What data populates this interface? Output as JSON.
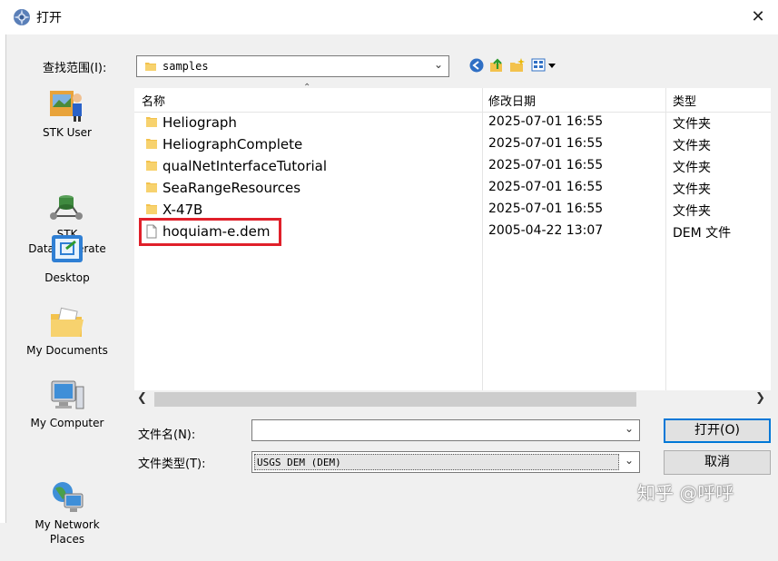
{
  "window": {
    "title": "打开",
    "close_glyph": "✕"
  },
  "look_in": {
    "label": "查找范围(I):",
    "value": "samples"
  },
  "places": [
    {
      "label": "STK User",
      "icon": "stk-user-icon"
    },
    {
      "label": "STK\nData Federate",
      "icon": "stk-data-federate-icon"
    },
    {
      "label": "Desktop",
      "icon": "desktop-icon"
    },
    {
      "label": "My Documents",
      "icon": "my-documents-icon"
    },
    {
      "label": "My Computer",
      "icon": "my-computer-icon"
    },
    {
      "label": "My Network\nPlaces",
      "icon": "my-network-places-icon"
    }
  ],
  "file_list": {
    "columns": {
      "name": "名称",
      "date": "修改日期",
      "type": "类型"
    },
    "rows": [
      {
        "name": "Heliograph",
        "date": "2025-07-01 16:55",
        "type": "文件夹",
        "kind": "folder"
      },
      {
        "name": "HeliographComplete",
        "date": "2025-07-01 16:55",
        "type": "文件夹",
        "kind": "folder"
      },
      {
        "name": "qualNetInterfaceTutorial",
        "date": "2025-07-01 16:55",
        "type": "文件夹",
        "kind": "folder"
      },
      {
        "name": "SeaRangeResources",
        "date": "2025-07-01 16:55",
        "type": "文件夹",
        "kind": "folder"
      },
      {
        "name": "X-47B",
        "date": "2025-07-01 16:55",
        "type": "文件夹",
        "kind": "folder"
      },
      {
        "name": "hoquiam-e.dem",
        "date": "2005-04-22 13:07",
        "type": "DEM 文件",
        "kind": "file"
      }
    ]
  },
  "bottom": {
    "filename_label": "文件名(N):",
    "filename_value": "",
    "filetype_label": "文件类型(T):",
    "filetype_value": "USGS DEM (DEM)",
    "open_label": "打开(O)",
    "cancel_label": "取消"
  },
  "watermark": "知乎 @呼呼",
  "colors": {
    "folder": "#f3c24c",
    "highlight": "#e0202a",
    "focus": "#0078d7"
  }
}
